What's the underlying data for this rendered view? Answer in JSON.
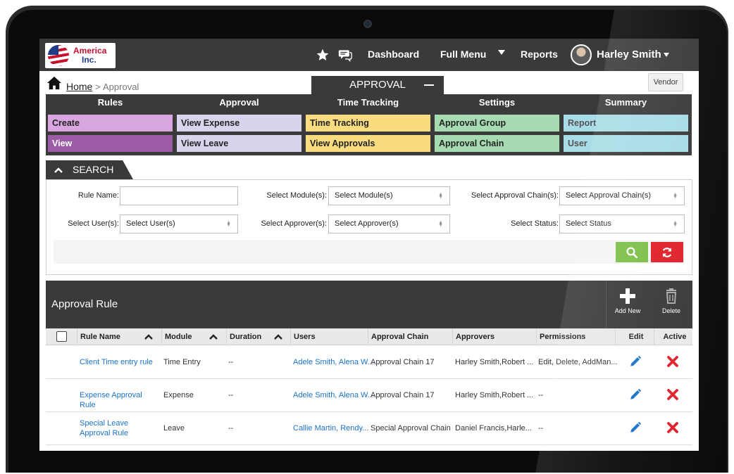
{
  "brand": {
    "name": "America",
    "suffix": "Inc."
  },
  "topnav": {
    "dashboard": "Dashboard",
    "full_menu": "Full Menu",
    "reports": "Reports",
    "user_name": "Harley Smith"
  },
  "breadcrumb": {
    "home": "Home",
    "separator": ">",
    "current": "Approval"
  },
  "section_tab": "APPROVAL",
  "vendor_button": "Vendor",
  "menu": {
    "columns": [
      {
        "head": "Rules",
        "items": [
          "Create",
          "View"
        ]
      },
      {
        "head": "Approval",
        "items": [
          "View Expense",
          "View Leave"
        ]
      },
      {
        "head": "Time Tracking",
        "items": [
          "Time Tracking",
          "View Approvals"
        ]
      },
      {
        "head": "Settings",
        "items": [
          "Approval Group",
          "Approval Chain"
        ]
      },
      {
        "head": "Summary",
        "items": [
          "Report",
          "User"
        ]
      }
    ]
  },
  "colors": {
    "rules_light": "#d9a6e0",
    "rules_dark": "#9b5ba5",
    "approval": "#d9d3ee",
    "time_tracking": "#f9db80",
    "settings": "#a7dcb3",
    "summary": "#a8dce6",
    "search_green": "#7cc048",
    "reset_red": "#e0202a",
    "link_blue": "#1a73c8"
  },
  "search": {
    "title": "SEARCH",
    "rule_name_label": "Rule Name:",
    "rule_name_value": "",
    "module_label": "Select Module(s):",
    "module_value": "Select Module(s)",
    "approval_chain_label": "Select Approval Chain(s):",
    "approval_chain_value": "Select Approval Chain(s)",
    "user_label": "Select User(s):",
    "user_value": "Select User(s)",
    "approver_label": "Select Approver(s):",
    "approver_value": "Select Approver(s)",
    "status_label": "Select Status:",
    "status_value": "Select Status"
  },
  "panel": {
    "title": "Approval Rule",
    "add_new": "Add New",
    "delete": "Delete"
  },
  "table": {
    "columns": [
      "Rule Name",
      "Module",
      "Duration",
      "Users",
      "Approval Chain",
      "Approvers",
      "Permissions",
      "Edit",
      "Active"
    ],
    "rows": [
      {
        "rule_name": "Client Time entry rule",
        "module": "Time Entry",
        "duration": "--",
        "users": "Adele Smith, Alena W...",
        "approval_chain": "Approval Chain 17",
        "approvers": "Harley Smith,Robert ...",
        "permissions": "Edit, Delete, AddMan..."
      },
      {
        "rule_name": "Expense Approval Rule",
        "module": "Expense",
        "duration": "--",
        "users": "Adele Smith, Alena W...",
        "approval_chain": "Approval Chain 17",
        "approvers": "Harley Smith,Robert ...",
        "permissions": "--"
      },
      {
        "rule_name": "Special Leave Approval Rule",
        "module": "Leave",
        "duration": "--",
        "users": "Callie Martin, Rendy...",
        "approval_chain": "Special Approval Chain",
        "approvers": "Daniel Francis,Harle...",
        "permissions": "--"
      }
    ]
  }
}
